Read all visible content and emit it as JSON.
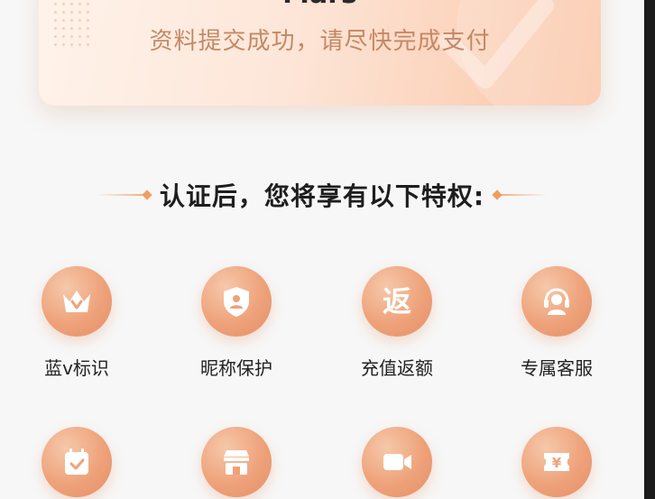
{
  "status_card": {
    "name": "Mars",
    "subtitle": "资料提交成功，请尽快完成支付"
  },
  "section": {
    "title": "认证后，您将享有以下特权:"
  },
  "benefits": [
    {
      "label": "蓝v标识",
      "icon": "crown-icon"
    },
    {
      "label": "昵称保护",
      "icon": "shield-user-icon"
    },
    {
      "label": "充值返额",
      "icon": "rebate-icon",
      "glyph": "返"
    },
    {
      "label": "专属客服",
      "icon": "headset-icon"
    },
    {
      "label": "",
      "icon": "calendar-check-icon"
    },
    {
      "label": "",
      "icon": "store-icon"
    },
    {
      "label": "",
      "icon": "video-camera-icon"
    },
    {
      "label": "",
      "icon": "coupon-yuan-icon",
      "glyph": "¥"
    }
  ],
  "colors": {
    "accent": "#ee9f76",
    "card_gradient_end": "#fac5a6",
    "subtitle": "#c48866"
  }
}
